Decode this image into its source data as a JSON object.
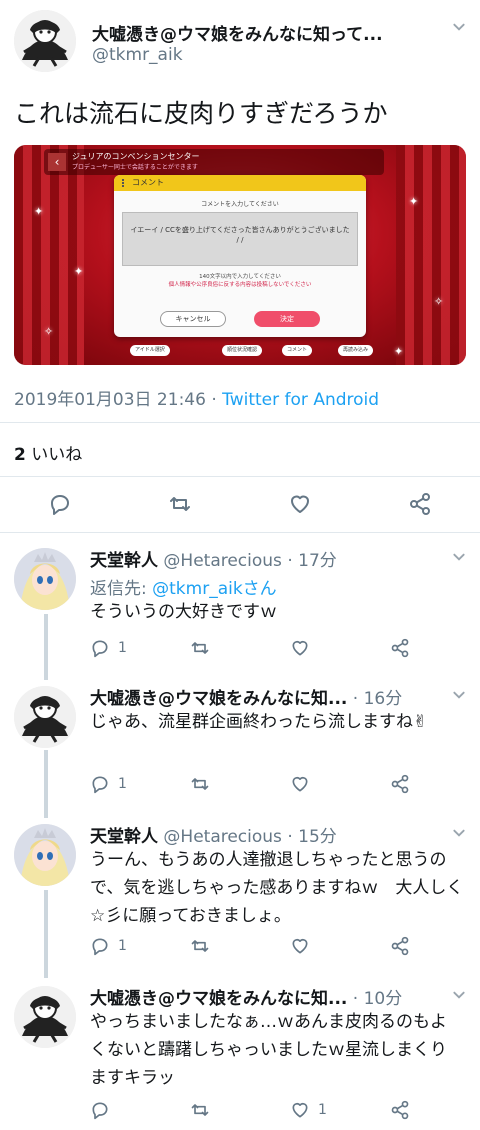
{
  "main_tweet": {
    "display_name": "大嘘憑き@ウマ娘をみんなに知って...",
    "handle": "@tkmr_aik",
    "text": "これは流石に皮肉りすぎだろうか",
    "timestamp": "2019年01月03日 21:46",
    "separator": " · ",
    "source": "Twitter for Android",
    "like_count": "2",
    "like_label": " いいね"
  },
  "media": {
    "screen_title": "ジュリアのコンベンションセンター",
    "screen_subtitle": "プロデューサー同士で会話することができます",
    "dialog_title": "コメント",
    "dialog_prompt": "コメントを入力してください",
    "dialog_text": "イエーイ / CCを盛り上げてくださった皆さんありがとうございました / /",
    "char_limit": "140文字以内で入力してください",
    "warning": "個人情報や公序良俗に反する内容は投稿しないでください",
    "cancel_label": "キャンセル",
    "ok_label": "決定",
    "bottom_items": [
      "アイドル選択",
      "順位状況確認",
      "コメント",
      "再読み込み"
    ]
  },
  "replies": [
    {
      "display_name": "天堂幹人",
      "handle": "@Hetarecious",
      "time": " · 17分",
      "reply_to_label": "返信先: ",
      "reply_to_user": "@tkmr_aikさん",
      "text": "そういうの大好きですｗ",
      "reply_count": "1",
      "like_count": ""
    },
    {
      "display_name": "大嘘憑き@ウマ娘をみんなに知...",
      "handle": "",
      "time": " · 16分",
      "text": "じゃあ、流星群企画終わったら流しますね✌",
      "reply_count": "1",
      "like_count": ""
    },
    {
      "display_name": "天堂幹人",
      "handle": "@Hetarecious",
      "time": " · 15分",
      "text": "うーん、もうあの人達撤退しちゃったと思うので、気を逃しちゃった感ありますねｗ　大人しく☆彡に願っておきましょ。",
      "reply_count": "1",
      "like_count": ""
    },
    {
      "display_name": "大嘘憑き@ウマ娘をみんなに知...",
      "handle": "",
      "time": " · 10分",
      "text": "やっちまいましたなぁ…ｗあんま皮肉るのもよくないと躊躇しちゃっいましたｗ星流しまくりますキラッ",
      "reply_count": "",
      "like_count": "1"
    }
  ],
  "icons": {
    "reply": "reply-icon",
    "retweet": "retweet-icon",
    "like": "heart-icon",
    "share": "share-icon",
    "more": "chevron-down-icon"
  },
  "colors": {
    "link": "#1da1f2",
    "secondary_text": "#657786",
    "primary_text": "#14171a",
    "divider": "#e1e8ed"
  }
}
